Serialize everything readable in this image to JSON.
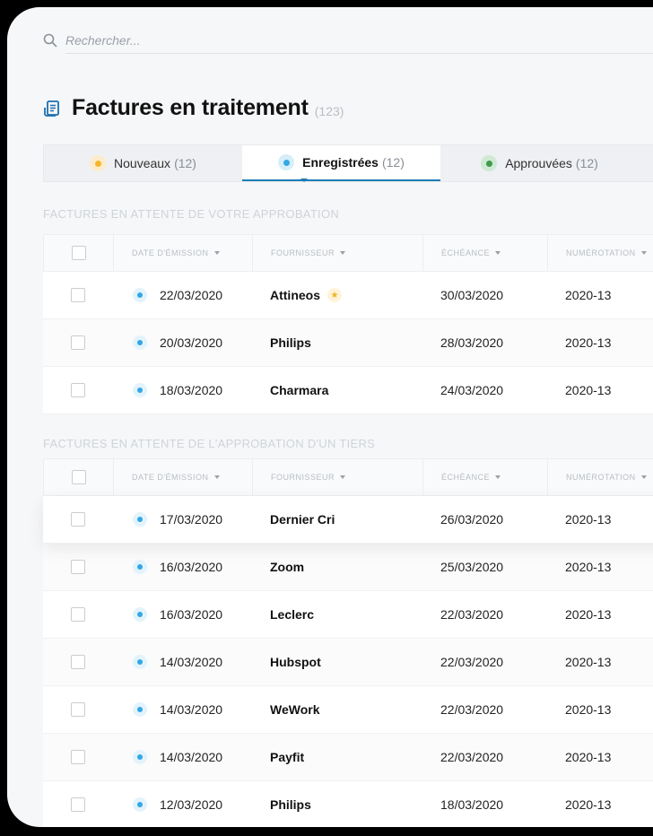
{
  "search": {
    "placeholder": "Rechercher..."
  },
  "page": {
    "title": "Factures en traitement",
    "count": "(123)"
  },
  "tabs": [
    {
      "label": "Nouveaux",
      "count": "(12)",
      "color": "#f5b62e",
      "ring": "#fdeccc"
    },
    {
      "label": "Enregistrées",
      "count": "(12)",
      "color": "#33a8e4",
      "ring": "#d6eefa"
    },
    {
      "label": "Approuvées",
      "count": "(12)",
      "color": "#3e9a4e",
      "ring": "#cfe9d3"
    }
  ],
  "columns": {
    "date": "DATE D'ÉMISSION",
    "supplier": "FOURNISSEUR",
    "due": "ÉCHÉANCE",
    "number": "NUMÉROTATION"
  },
  "section1": {
    "title": "Factures en attente de votre approbation",
    "rows": [
      {
        "date": "22/03/2020",
        "supplier": "Attineos",
        "due": "30/03/2020",
        "number": "2020-13",
        "star": "★"
      },
      {
        "date": "20/03/2020",
        "supplier": "Philips",
        "due": "28/03/2020",
        "number": "2020-13"
      },
      {
        "date": "18/03/2020",
        "supplier": "Charmara",
        "due": "24/03/2020",
        "number": "2020-13"
      }
    ]
  },
  "section2": {
    "title": "Factures en attente de l'approbation d'un tiers",
    "rows": [
      {
        "date": "17/03/2020",
        "supplier": "Dernier Cri",
        "due": "26/03/2020",
        "number": "2020-13"
      },
      {
        "date": "16/03/2020",
        "supplier": "Zoom",
        "due": "25/03/2020",
        "number": "2020-13"
      },
      {
        "date": "16/03/2020",
        "supplier": "Leclerc",
        "due": "22/03/2020",
        "number": "2020-13"
      },
      {
        "date": "14/03/2020",
        "supplier": "Hubspot",
        "due": "22/03/2020",
        "number": "2020-13"
      },
      {
        "date": "14/03/2020",
        "supplier": "WeWork",
        "due": "22/03/2020",
        "number": "2020-13"
      },
      {
        "date": "14/03/2020",
        "supplier": "Payfit",
        "due": "22/03/2020",
        "number": "2020-13"
      },
      {
        "date": "12/03/2020",
        "supplier": "Philips",
        "due": "18/03/2020",
        "number": "2020-13"
      }
    ]
  },
  "icons": {
    "search": "search-icon",
    "title": "invoice-document-icon",
    "sort": "sort-down-icon",
    "star": "star-icon"
  }
}
